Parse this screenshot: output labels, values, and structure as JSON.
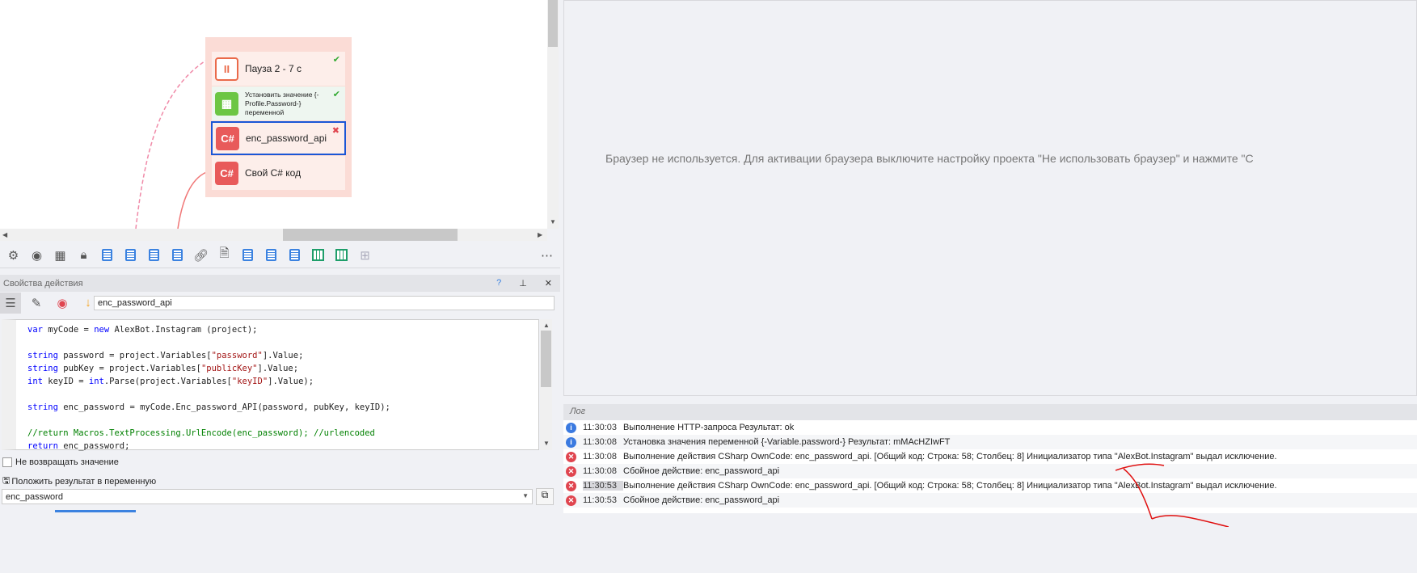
{
  "canvas": {
    "nodes": [
      {
        "label": "Пауза 2 - 7 с",
        "icon": "pause-icon",
        "status": "✔"
      },
      {
        "label": "Установить значение {-Profile.Password-} переменной",
        "icon": "grid-icon",
        "status": "✔"
      },
      {
        "label": "enc_password_api",
        "icon": "csharp-icon",
        "icon_text": "C#",
        "status": "✖"
      },
      {
        "label": "Свой C# код",
        "icon": "csharp-icon",
        "icon_text": "C#"
      }
    ]
  },
  "properties": {
    "title": "Свойства действия",
    "help": "?",
    "pin": "⊥",
    "close": "✕",
    "name_value": "enc_password_api",
    "no_return_label": "Не возвращать значение",
    "save_result_label": "Положить результат в переменную",
    "variable_value": "enc_password"
  },
  "code": {
    "lines": [
      "var myCode = new AlexBot.Instagram (project);",
      "",
      "string password = project.Variables[\"password\"].Value;",
      "string pubKey = project.Variables[\"publicKey\"].Value;",
      "int keyID = int.Parse(project.Variables[\"keyID\"].Value);",
      "",
      "string enc_password = myCode.Enc_password_API(password, pubKey, keyID);",
      "",
      "//return Macros.TextProcessing.UrlEncode(enc_password); //urlencoded",
      "return enc_password;"
    ]
  },
  "browser": {
    "message": "Браузер не используется. Для активации браузера выключите настройку проекта \"Не использовать браузер\" и нажмите \"С"
  },
  "log": {
    "title": "Лог",
    "rows": [
      {
        "type": "info",
        "time": "11:30:03",
        "text": "Выполнение HTTP-запроса  Результат: ok"
      },
      {
        "type": "info",
        "time": "11:30:08",
        "text": "Установка значения переменной {-Variable.password-}  Результат: mMAcHZIwFT"
      },
      {
        "type": "error",
        "time": "11:30:08",
        "text": "Выполнение действия CSharp OwnCode: enc_password_api. [Общий код: Строка: 58; Столбец: 8] Инициализатор типа \"AlexBot.Instagram\" выдал исключение."
      },
      {
        "type": "error",
        "time": "11:30:08",
        "text": "Сбойное действие: enc_password_api"
      },
      {
        "type": "error",
        "time": "11:30:53",
        "text": "Выполнение действия CSharp OwnCode: enc_password_api. [Общий код: Строка: 58; Столбец: 8] Инициализатор типа \"AlexBot.Instagram\" выдал исключение."
      },
      {
        "type": "error",
        "time": "11:30:53",
        "text": "Сбойное действие: enc_password_api"
      }
    ]
  },
  "colors": {
    "accent": "#3b82e0",
    "error": "#e0454f",
    "node_group": "#fbdcd6"
  }
}
